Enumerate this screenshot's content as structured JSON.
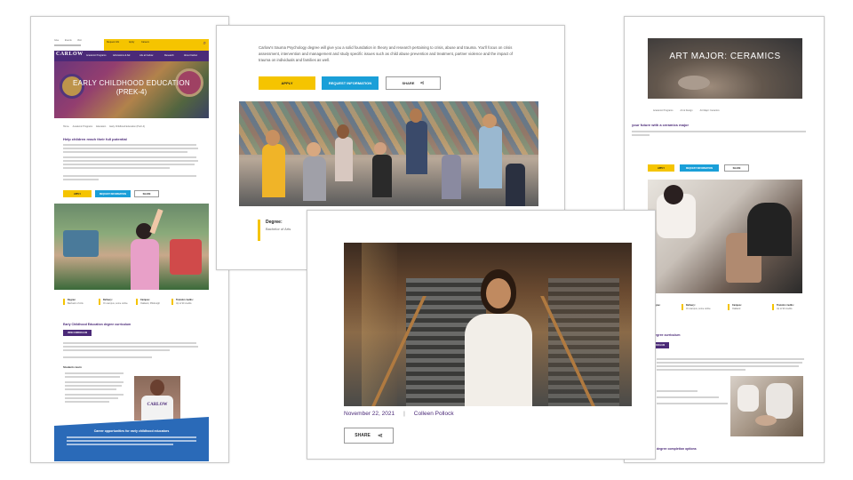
{
  "page1": {
    "utility_links": [
      "Give",
      "Events",
      "Visit",
      "Request Info",
      "Apply",
      "Careers"
    ],
    "brand": "CARLOW",
    "nav": [
      "Academic Programs",
      "Admissions & Aid",
      "Life at Carlow",
      "Research",
      "About Carlow"
    ],
    "hero_title": "EARLY CHILDHOOD EDUCATION",
    "hero_subtitle": "(PREK-4)",
    "breadcrumb": [
      "Home",
      "Academic Programs",
      "Education",
      "Early Childhood Education (PreK-4)"
    ],
    "intro_heading": "Help children reach their full potential",
    "btn_apply": "APPLY",
    "btn_request": "REQUEST INFORMATION",
    "btn_share": "SHARE",
    "facts": [
      {
        "label": "Degree:",
        "value": "Bachelor of Arts"
      },
      {
        "label": "Delivery:",
        "value": "On campus, some online"
      },
      {
        "label": "Campus:",
        "value": "Oakland, Pittsburgh"
      },
      {
        "label": "Transfer credits:",
        "value": "Up to 90 credits"
      }
    ],
    "curriculum_heading": "Early Childhood Education degree curriculum",
    "curriculum_btn": "VIEW CURRICULUM",
    "students_heading": "Students learn",
    "shirt_text": "CARLOW",
    "footer_heading": "Career opportunities for early childhood educators"
  },
  "page2": {
    "intro_text": "Carlow's trauma Psychology degree will give you a solid foundation in theory and research pertaining to crisis, abuse and trauma. You'll focus on crisis assessment, intervention and management and study specific issues such as child abuse prevention and treatment, partner violence and the impact of trauma on individuals and families as well.",
    "btn_apply": "APPLY",
    "btn_request": "REQUEST INFORMATION",
    "btn_share": "SHARE",
    "degree_label": "Degree:",
    "degree_value": "Bachelor of Arts"
  },
  "page3": {
    "hero_title": "ART MAJOR: CERAMICS",
    "breadcrumb": [
      "Academic Programs",
      "Art & Design",
      "Art Major: Ceramics"
    ],
    "intro_heading": "your future with a ceramics major",
    "btn_apply": "APPLY",
    "btn_request": "REQUEST INFORMATION",
    "btn_share": "SHARE",
    "facts": [
      {
        "label": "Degree:",
        "value": ""
      },
      {
        "label": "Delivery:",
        "value": "On campus, some online"
      },
      {
        "label": "Campus:",
        "value": "Oakland"
      },
      {
        "label": "Transfer credits:",
        "value": "Up to 90 credits"
      }
    ],
    "curriculum_heading": "degree curriculum",
    "curriculum_btn": "VIEW CURRICULUM",
    "completion_heading": "degree completion options"
  },
  "page4": {
    "date": "November 22, 2021",
    "author": "Colleen Pollock",
    "btn_share": "SHARE"
  }
}
